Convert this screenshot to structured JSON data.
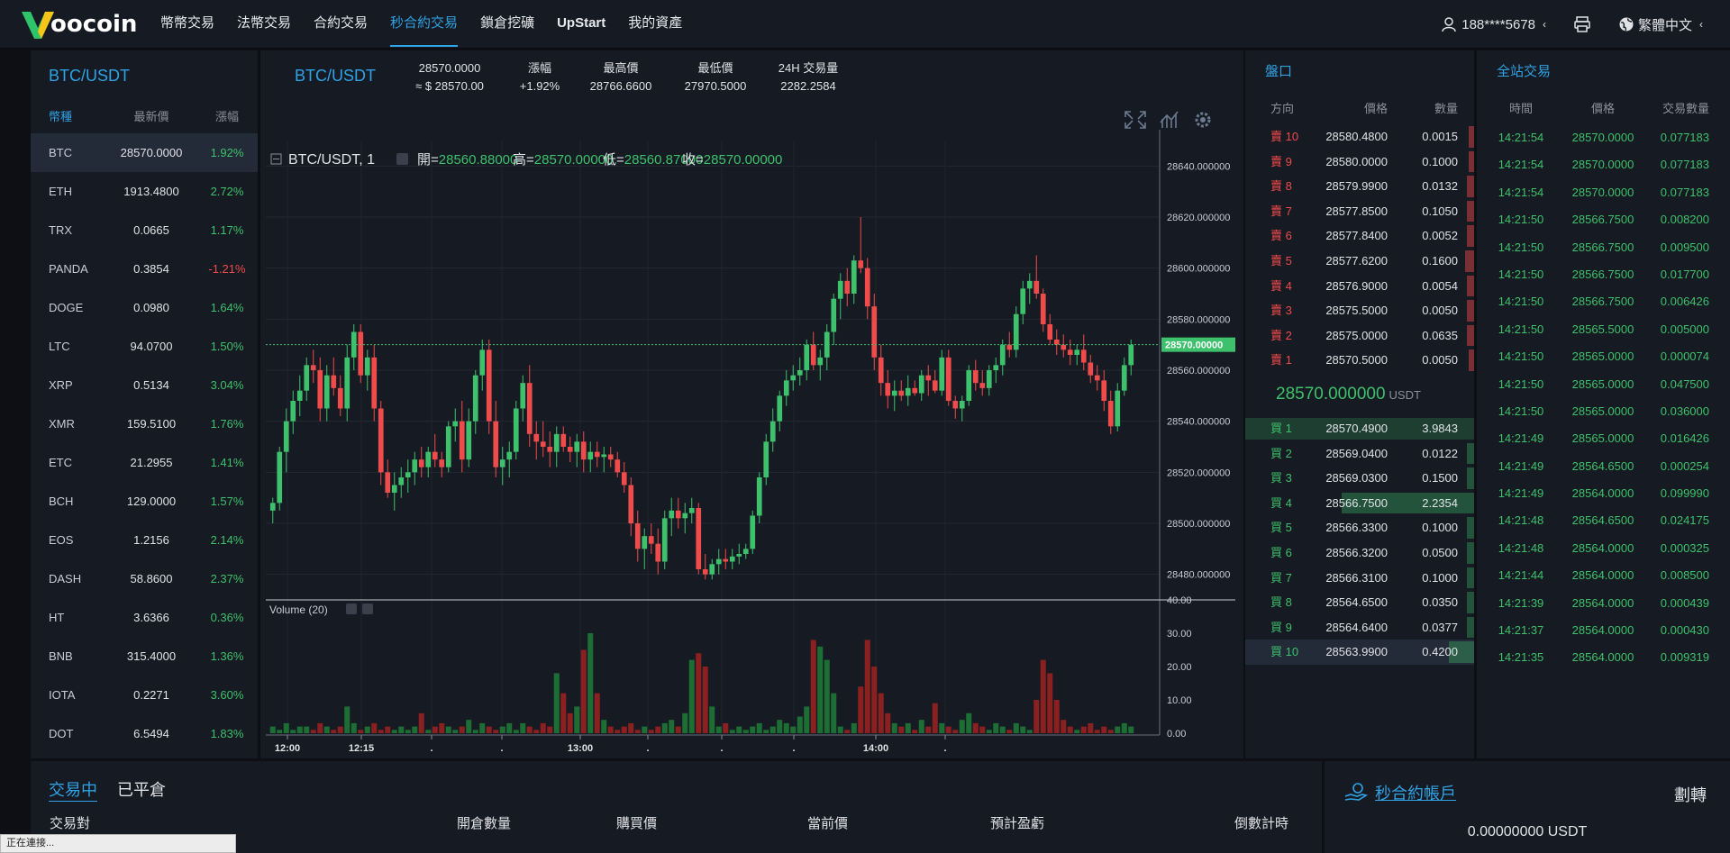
{
  "nav": {
    "logo_text": "oocoin",
    "menu": [
      "幣幣交易",
      "法幣交易",
      "合約交易",
      "秒合約交易",
      "鎖倉挖礦",
      "UpStart",
      "我的資產"
    ],
    "active_index": 3,
    "user": "188****5678",
    "language": "繁體中文",
    "accent": "#2fa3e6"
  },
  "markets": {
    "pair": "BTC/USDT",
    "headers": [
      "幣種",
      "最新價",
      "漲幅"
    ],
    "rows": [
      {
        "coin": "BTC",
        "price": "28570.0000",
        "change": "1.92%",
        "up": true
      },
      {
        "coin": "ETH",
        "price": "1913.4800",
        "change": "2.72%",
        "up": true
      },
      {
        "coin": "TRX",
        "price": "0.0665",
        "change": "1.17%",
        "up": true
      },
      {
        "coin": "PANDA",
        "price": "0.3854",
        "change": "-1.21%",
        "up": false
      },
      {
        "coin": "DOGE",
        "price": "0.0980",
        "change": "1.64%",
        "up": true
      },
      {
        "coin": "LTC",
        "price": "94.0700",
        "change": "1.50%",
        "up": true
      },
      {
        "coin": "XRP",
        "price": "0.5134",
        "change": "3.04%",
        "up": true
      },
      {
        "coin": "XMR",
        "price": "159.5100",
        "change": "1.76%",
        "up": true
      },
      {
        "coin": "ETC",
        "price": "21.2955",
        "change": "1.41%",
        "up": true
      },
      {
        "coin": "BCH",
        "price": "129.0000",
        "change": "1.57%",
        "up": true
      },
      {
        "coin": "EOS",
        "price": "1.2156",
        "change": "2.14%",
        "up": true
      },
      {
        "coin": "DASH",
        "price": "58.8600",
        "change": "2.37%",
        "up": true
      },
      {
        "coin": "HT",
        "price": "3.6366",
        "change": "0.36%",
        "up": true
      },
      {
        "coin": "BNB",
        "price": "315.4000",
        "change": "1.36%",
        "up": true
      },
      {
        "coin": "IOTA",
        "price": "0.2271",
        "change": "3.60%",
        "up": true
      },
      {
        "coin": "DOT",
        "price": "6.5494",
        "change": "1.83%",
        "up": true
      }
    ]
  },
  "ticker": {
    "symbol": "BTC/USDT",
    "price": "28570.0000",
    "price_usd": "≈ $ 28570.00",
    "change_label": "漲幅",
    "change": "+1.92%",
    "high_label": "最高價",
    "high": "28766.6600",
    "low_label": "最低價",
    "low": "27970.5000",
    "vol_label": "24H 交易量",
    "vol": "2282.2584"
  },
  "chart_data": {
    "type": "candlestick",
    "title": "BTC/USDT, 1",
    "ohlc_labels": {
      "open": "開=",
      "high": "高=",
      "low": "低=",
      "close": "收="
    },
    "ohlc_values": {
      "open": "28560.88000",
      "high": "28570.00000",
      "low": "28560.87000",
      "close": "28570.00000"
    },
    "last_price_label": "28570.00000",
    "last_price": 28570,
    "yticks": [
      "28640.000000",
      "28620.000000",
      "28600.000000",
      "28580.000000",
      "28560.000000",
      "28540.000000",
      "28520.000000",
      "28500.000000",
      "28480.000000"
    ],
    "ytick_values": [
      28640,
      28620,
      28600,
      28580,
      28560,
      28540,
      28520,
      28500,
      28480
    ],
    "xticks": [
      "12:00",
      "12:15",
      ".",
      ".",
      "13:00",
      ".",
      ".",
      ".",
      "14:00",
      "."
    ],
    "volume_label": "Volume (20)",
    "volume_yticks": [
      "40.00",
      "30.00",
      "20.00",
      "10.00",
      "0.00"
    ],
    "volume_ytick_values": [
      40,
      30,
      20,
      10,
      0
    ],
    "candles": [
      [
        28505,
        28510,
        28500,
        28508
      ],
      [
        28508,
        28530,
        28505,
        28528
      ],
      [
        28528,
        28545,
        28520,
        28540
      ],
      [
        28540,
        28552,
        28535,
        28548
      ],
      [
        28548,
        28558,
        28542,
        28552
      ],
      [
        28552,
        28565,
        28548,
        28562
      ],
      [
        28562,
        28568,
        28555,
        28560
      ],
      [
        28560,
        28565,
        28540,
        28545
      ],
      [
        28545,
        28562,
        28540,
        28558
      ],
      [
        28558,
        28565,
        28550,
        28553
      ],
      [
        28553,
        28558,
        28542,
        28545
      ],
      [
        28545,
        28570,
        28540,
        28565
      ],
      [
        28565,
        28578,
        28560,
        28575
      ],
      [
        28575,
        28578,
        28555,
        28558
      ],
      [
        28558,
        28568,
        28552,
        28565
      ],
      [
        28565,
        28570,
        28540,
        28545
      ],
      [
        28545,
        28548,
        28515,
        28520
      ],
      [
        28520,
        28525,
        28510,
        28512
      ],
      [
        28512,
        28520,
        28505,
        28515
      ],
      [
        28515,
        28522,
        28510,
        28518
      ],
      [
        28518,
        28525,
        28512,
        28520
      ],
      [
        28520,
        28528,
        28515,
        28525
      ],
      [
        28525,
        28530,
        28518,
        28522
      ],
      [
        28522,
        28530,
        28518,
        28528
      ],
      [
        28528,
        28535,
        28522,
        28525
      ],
      [
        28525,
        28528,
        28518,
        28522
      ],
      [
        28522,
        28540,
        28520,
        28538
      ],
      [
        28538,
        28545,
        28532,
        28540
      ],
      [
        28540,
        28548,
        28520,
        28525
      ],
      [
        28525,
        28545,
        28522,
        28540
      ],
      [
        28540,
        28560,
        28535,
        28558
      ],
      [
        28558,
        28572,
        28552,
        28568
      ],
      [
        28568,
        28572,
        28535,
        28540
      ],
      [
        28540,
        28548,
        28518,
        28522
      ],
      [
        28522,
        28530,
        28515,
        28525
      ],
      [
        28525,
        28532,
        28518,
        28528
      ],
      [
        28528,
        28548,
        28525,
        28545
      ],
      [
        28545,
        28558,
        28540,
        28555
      ],
      [
        28555,
        28562,
        28530,
        28535
      ],
      [
        28535,
        28540,
        28525,
        28532
      ],
      [
        28532,
        28540,
        28526,
        28530
      ],
      [
        28530,
        28536,
        28522,
        28528
      ],
      [
        28528,
        28538,
        28522,
        28535
      ],
      [
        28535,
        28538,
        28528,
        28530
      ],
      [
        28530,
        28534,
        28524,
        28528
      ],
      [
        28528,
        28535,
        28522,
        28532
      ],
      [
        28532,
        28536,
        28520,
        28525
      ],
      [
        28525,
        28532,
        28520,
        28528
      ],
      [
        28528,
        28532,
        28522,
        28526
      ],
      [
        28526,
        28530,
        28520,
        28527
      ],
      [
        28527,
        28530,
        28522,
        28525
      ],
      [
        28525,
        28528,
        28518,
        28520
      ],
      [
        28520,
        28524,
        28512,
        28515
      ],
      [
        28515,
        28518,
        28495,
        28500
      ],
      [
        28500,
        28505,
        28485,
        28490
      ],
      [
        28490,
        28498,
        28482,
        28495
      ],
      [
        28495,
        28500,
        28488,
        28492
      ],
      [
        28492,
        28498,
        28480,
        28485
      ],
      [
        28485,
        28505,
        28482,
        28502
      ],
      [
        28502,
        28510,
        28495,
        28505
      ],
      [
        28505,
        28510,
        28498,
        28502
      ],
      [
        28502,
        28508,
        28496,
        28504
      ],
      [
        28504,
        28510,
        28500,
        28506
      ],
      [
        28506,
        28508,
        28480,
        28482
      ],
      [
        28482,
        28488,
        28478,
        28480
      ],
      [
        28480,
        28486,
        28478,
        28484
      ],
      [
        28484,
        28490,
        28480,
        28486
      ],
      [
        28486,
        28490,
        28482,
        28485
      ],
      [
        28485,
        28490,
        28482,
        28487
      ],
      [
        28487,
        28492,
        28484,
        28488
      ],
      [
        28488,
        28492,
        28486,
        28490
      ],
      [
        28490,
        28505,
        28488,
        28503
      ],
      [
        28503,
        28520,
        28500,
        28518
      ],
      [
        28518,
        28535,
        28515,
        28532
      ],
      [
        28532,
        28545,
        28528,
        28540
      ],
      [
        28540,
        28552,
        28536,
        28550
      ],
      [
        28550,
        28560,
        28546,
        28556
      ],
      [
        28556,
        28562,
        28552,
        28558
      ],
      [
        28558,
        28565,
        28554,
        28560
      ],
      [
        28560,
        28572,
        28556,
        28570
      ],
      [
        28570,
        28575,
        28560,
        28562
      ],
      [
        28562,
        28568,
        28556,
        28565
      ],
      [
        28565,
        28578,
        28560,
        28575
      ],
      [
        28575,
        28590,
        28570,
        28588
      ],
      [
        28588,
        28598,
        28580,
        28595
      ],
      [
        28595,
        28600,
        28585,
        28590
      ],
      [
        28590,
        28605,
        28586,
        28603
      ],
      [
        28603,
        28620,
        28598,
        28600
      ],
      [
        28600,
        28604,
        28580,
        28585
      ],
      [
        28585,
        28590,
        28560,
        28565
      ],
      [
        28565,
        28570,
        28550,
        28555
      ],
      [
        28555,
        28560,
        28545,
        28550
      ],
      [
        28550,
        28556,
        28544,
        28552
      ],
      [
        28552,
        28556,
        28548,
        28550
      ],
      [
        28550,
        28558,
        28546,
        28553
      ],
      [
        28553,
        28556,
        28550,
        28551
      ],
      [
        28551,
        28560,
        28548,
        28558
      ],
      [
        28558,
        28562,
        28550,
        28556
      ],
      [
        28556,
        28560,
        28551,
        28552
      ],
      [
        28552,
        28568,
        28550,
        28565
      ],
      [
        28565,
        28568,
        28546,
        28548
      ],
      [
        28548,
        28550,
        28541,
        28545
      ],
      [
        28545,
        28550,
        28540,
        28548
      ],
      [
        28548,
        28562,
        28546,
        28560
      ],
      [
        28560,
        28564,
        28552,
        28555
      ],
      [
        28555,
        28560,
        28550,
        28553
      ],
      [
        28553,
        28562,
        28550,
        28560
      ],
      [
        28560,
        28565,
        28555,
        28562
      ],
      [
        28562,
        28572,
        28558,
        28570
      ],
      [
        28570,
        28575,
        28565,
        28568
      ],
      [
        28568,
        28585,
        28565,
        28582
      ],
      [
        28582,
        28595,
        28578,
        28592
      ],
      [
        28592,
        28598,
        28586,
        28595
      ],
      [
        28595,
        28605,
        28588,
        28590
      ],
      [
        28590,
        28592,
        28575,
        28578
      ],
      [
        28578,
        28582,
        28570,
        28572
      ],
      [
        28572,
        28576,
        28566,
        28570
      ],
      [
        28570,
        28574,
        28565,
        28568
      ],
      [
        28568,
        28572,
        28562,
        28566
      ],
      [
        28566,
        28570,
        28562,
        28568
      ],
      [
        28568,
        28574,
        28560,
        28563
      ],
      [
        28563,
        28566,
        28555,
        28558
      ],
      [
        28558,
        28562,
        28552,
        28556
      ],
      [
        28556,
        28560,
        28544,
        28548
      ],
      [
        28548,
        28552,
        28535,
        28538
      ],
      [
        28538,
        28555,
        28536,
        28552
      ],
      [
        28552,
        28565,
        28550,
        28562
      ],
      [
        28562,
        28572,
        28558,
        28570
      ]
    ],
    "volumes": [
      2,
      1,
      3,
      1,
      2,
      2,
      1,
      3,
      2,
      1,
      2,
      8,
      3,
      1,
      2,
      3,
      1,
      2,
      1,
      2,
      1,
      2,
      6,
      1,
      2,
      3,
      2,
      1,
      2,
      4,
      1,
      3,
      2,
      1,
      2,
      3,
      1,
      3,
      2,
      1,
      3,
      2,
      18,
      12,
      6,
      8,
      25,
      30,
      12,
      4,
      2,
      1,
      2,
      3,
      1,
      2,
      1,
      2,
      3,
      4,
      2,
      6,
      22,
      24,
      20,
      8,
      2,
      3,
      1,
      2,
      1,
      2,
      3,
      1,
      2,
      4,
      3,
      2,
      5,
      8,
      28,
      26,
      22,
      12,
      2,
      1,
      3,
      14,
      28,
      20,
      12,
      6,
      3,
      2,
      3,
      1,
      4,
      2,
      9,
      3,
      2,
      1,
      4,
      6,
      3,
      2,
      1,
      3,
      2,
      1,
      3,
      2,
      1,
      10,
      22,
      18,
      10,
      4,
      2,
      1,
      2,
      3,
      1,
      2,
      1,
      2,
      3,
      2,
      1,
      3,
      9,
      6,
      2
    ]
  },
  "orderbook": {
    "title": "盤口",
    "headers": [
      "方向",
      "價格",
      "數量"
    ],
    "asks": [
      {
        "side": "賣 10",
        "price": "28580.4800",
        "qty": "0.0015",
        "depth": 0.01
      },
      {
        "side": "賣 9",
        "price": "28580.0000",
        "qty": "0.1000",
        "depth": 0.02
      },
      {
        "side": "賣 8",
        "price": "28579.9900",
        "qty": "0.0132",
        "depth": 0.03
      },
      {
        "side": "賣 7",
        "price": "28577.8500",
        "qty": "0.1050",
        "depth": 0.03
      },
      {
        "side": "賣 6",
        "price": "28577.8400",
        "qty": "0.0052",
        "depth": 0.03
      },
      {
        "side": "賣 5",
        "price": "28577.6200",
        "qty": "0.1600",
        "depth": 0.04
      },
      {
        "side": "賣 4",
        "price": "28576.9000",
        "qty": "0.0054",
        "depth": 0.03
      },
      {
        "side": "賣 3",
        "price": "28575.5000",
        "qty": "0.0050",
        "depth": 0.03
      },
      {
        "side": "賣 2",
        "price": "28575.0000",
        "qty": "0.0635",
        "depth": 0.03
      },
      {
        "side": "賣 1",
        "price": "28570.5000",
        "qty": "0.0050",
        "depth": 0.01
      }
    ],
    "mid_price": "28570.000000",
    "mid_unit": "USDT",
    "bids": [
      {
        "side": "買 1",
        "price": "28570.4900",
        "qty": "3.9843",
        "depth": 1.0
      },
      {
        "side": "買 2",
        "price": "28569.0400",
        "qty": "0.0122",
        "depth": 0.03
      },
      {
        "side": "買 3",
        "price": "28569.0300",
        "qty": "0.1500",
        "depth": 0.03
      },
      {
        "side": "買 4",
        "price": "28566.7500",
        "qty": "2.2354",
        "depth": 0.58
      },
      {
        "side": "買 5",
        "price": "28566.3300",
        "qty": "0.1000",
        "depth": 0.03
      },
      {
        "side": "買 6",
        "price": "28566.3200",
        "qty": "0.0500",
        "depth": 0.03
      },
      {
        "side": "買 7",
        "price": "28566.3100",
        "qty": "0.1000",
        "depth": 0.03
      },
      {
        "side": "買 8",
        "price": "28564.6500",
        "qty": "0.0350",
        "depth": 0.03
      },
      {
        "side": "買 9",
        "price": "28564.6400",
        "qty": "0.0377",
        "depth": 0.03
      },
      {
        "side": "買 10",
        "price": "28563.9900",
        "qty": "0.4200",
        "depth": 0.11
      }
    ]
  },
  "trades": {
    "title": "全站交易",
    "headers": [
      "時間",
      "價格",
      "交易數量"
    ],
    "rows": [
      [
        "14:21:54",
        "28570.0000",
        "0.077183"
      ],
      [
        "14:21:54",
        "28570.0000",
        "0.077183"
      ],
      [
        "14:21:54",
        "28570.0000",
        "0.077183"
      ],
      [
        "14:21:50",
        "28566.7500",
        "0.008200"
      ],
      [
        "14:21:50",
        "28566.7500",
        "0.009500"
      ],
      [
        "14:21:50",
        "28566.7500",
        "0.017700"
      ],
      [
        "14:21:50",
        "28566.7500",
        "0.006426"
      ],
      [
        "14:21:50",
        "28565.5000",
        "0.005000"
      ],
      [
        "14:21:50",
        "28565.0000",
        "0.000074"
      ],
      [
        "14:21:50",
        "28565.0000",
        "0.047500"
      ],
      [
        "14:21:50",
        "28565.0000",
        "0.036000"
      ],
      [
        "14:21:49",
        "28565.0000",
        "0.016426"
      ],
      [
        "14:21:49",
        "28564.6500",
        "0.000254"
      ],
      [
        "14:21:49",
        "28564.0000",
        "0.099990"
      ],
      [
        "14:21:48",
        "28564.6500",
        "0.024175"
      ],
      [
        "14:21:48",
        "28564.0000",
        "0.000325"
      ],
      [
        "14:21:44",
        "28564.0000",
        "0.008500"
      ],
      [
        "14:21:39",
        "28564.0000",
        "0.000439"
      ],
      [
        "14:21:37",
        "28564.0000",
        "0.000430"
      ],
      [
        "14:21:35",
        "28564.0000",
        "0.009319"
      ]
    ]
  },
  "positions": {
    "tab_active": "交易中",
    "tab_closed": "已平倉",
    "columns": [
      "交易對",
      "開倉數量",
      "購買價",
      "當前價",
      "預計盈虧",
      "倒數計時"
    ]
  },
  "account": {
    "title": "秒合約帳戶",
    "transfer": "劃轉",
    "balance": "0.00000000 USDT"
  },
  "status_bar": "正在連接..."
}
